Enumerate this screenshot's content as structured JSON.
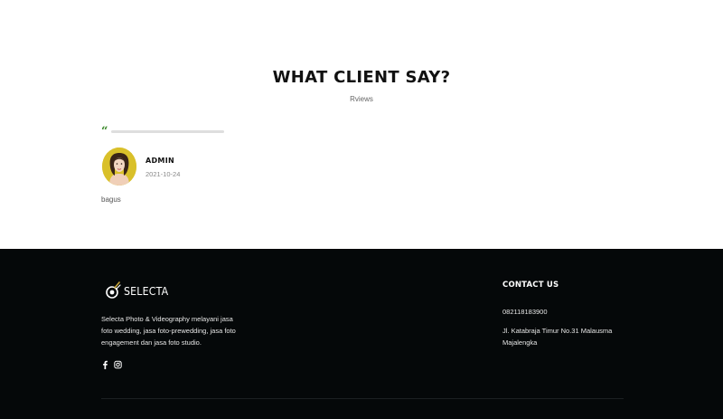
{
  "reviews_section": {
    "title": "WHAT CLIENT SAY?",
    "subtitle": "Rviews",
    "review": {
      "reviewer_name": "ADMIN",
      "date": "2021-10-24",
      "text": "bagus"
    }
  },
  "footer": {
    "brand_name": "SELECTA",
    "description": "Selecta Photo & Videography melayani jasa foto wedding, jasa foto-prewedding, jasa foto engagement dan jasa foto studio.",
    "social_icons": [
      "facebook-icon",
      "instagram-icon"
    ],
    "contact": {
      "heading": "CONTACT US",
      "phone": "082118183900",
      "address": "Jl. Katabraja Timur No.31 Malausma Majalengka"
    }
  },
  "colors": {
    "accent_quote": "#3d8a2d",
    "footer_background": "#050809",
    "avatar_background": "#d9c02a"
  }
}
